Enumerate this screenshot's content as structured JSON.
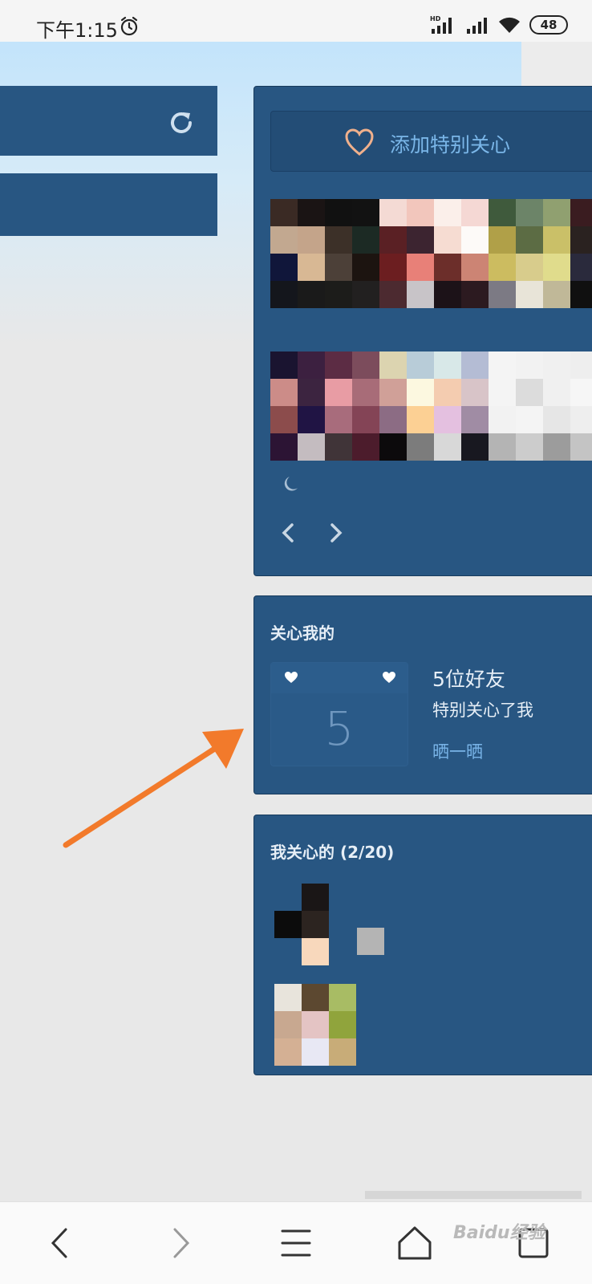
{
  "status_bar": {
    "time": "下午1:15",
    "battery": "48",
    "network_badge": "HD"
  },
  "left_panel": {
    "refresh_icon": "refresh-icon"
  },
  "special_care": {
    "add_button_label": "添加特别关心",
    "prev_icon": "chevron-left-icon",
    "next_icon": "chevron-right-icon"
  },
  "cares_about_me": {
    "title": "关心我的",
    "count": "5",
    "friends_text": "5位好友",
    "description": "特别关心了我",
    "share_link": "晒一晒"
  },
  "i_care_about": {
    "title": "我关心的 (2/20)"
  },
  "watermark": "Baidu经验",
  "colors": {
    "panel_blue": "#285682",
    "link_blue": "#79b4e8",
    "annotation_orange": "#f27a2b"
  }
}
